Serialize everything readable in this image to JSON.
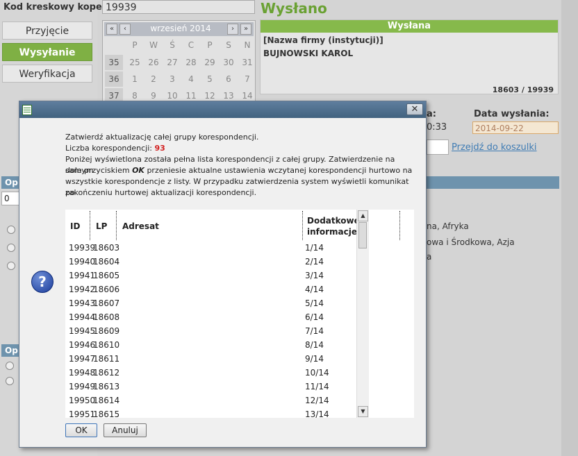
{
  "header": {
    "barcode_label": "Kod kreskowy koperty",
    "barcode_value": "19939",
    "status_title": "Wysłano"
  },
  "nav": [
    {
      "label": "Przyjęcie",
      "active": false
    },
    {
      "label": "Wysyłanie",
      "active": true
    },
    {
      "label": "Weryfikacja",
      "active": false
    }
  ],
  "calendar": {
    "title": "wrzesień 2014",
    "prev_year": "«",
    "prev_month": "‹",
    "next_month": "›",
    "next_year": "»",
    "day_names": [
      "P",
      "W",
      "Ś",
      "C",
      "P",
      "S",
      "N"
    ],
    "weeks": [
      {
        "week": "35",
        "days": [
          "25",
          "26",
          "27",
          "28",
          "29",
          "30",
          "31"
        ]
      },
      {
        "week": "36",
        "days": [
          "1",
          "2",
          "3",
          "4",
          "5",
          "6",
          "7"
        ]
      },
      {
        "week": "37",
        "days": [
          "8",
          "9",
          "10",
          "11",
          "12",
          "13",
          "14"
        ]
      }
    ]
  },
  "panel": {
    "header": "Wysłana",
    "firm_label": "[Nazwa firmy (instytucji)]",
    "name": "BUJNOWSKI KAROL",
    "numbers": "18603 / 19939"
  },
  "background_right": {
    "time_fragment": "0:33",
    "label_fragment": "a:",
    "send_date_label": "Data wysłania:",
    "send_date_value": "2014-09-22",
    "basket_link": "Przejdź do koszulki",
    "region_1": "na, Afryka",
    "region_2": "owa i Środkowa, Azja",
    "region_3": "a"
  },
  "background_left": {
    "op_label_1": "Op",
    "op_label_2": "Op",
    "field_value": "0"
  },
  "dialog": {
    "line1": "Zatwierdź aktualizację całej grupy korespondencji.",
    "count_label": "Liczba korespondencji:",
    "count_value": "93",
    "line3": "Poniżej wyświetlona została pełna lista korespondencji z całej grupy. Zatwierdzenie na samym",
    "line4_pre": "dole przyciskiem",
    "line4_ok": "OK",
    "line4_post": "przeniesie aktualne ustawienia wczytanej korespondencji hurtowo na",
    "line5": "wszystkie korespondencje z listy. W przypadku zatwierdzenia system wyświetli komunikat po",
    "line6": "zakończeniu hurtowej aktualizacji korespondencji.",
    "close_symbol": "✕",
    "help_symbol": "?",
    "columns": {
      "id": "ID",
      "lp": "LP",
      "address": "Adresat",
      "extra_1": "Dodatkowe",
      "extra_2": "informacje"
    },
    "rows": [
      {
        "id": "19939",
        "lp": "18603",
        "info": "1/14"
      },
      {
        "id": "19940",
        "lp": "18604",
        "info": "2/14"
      },
      {
        "id": "19941",
        "lp": "18605",
        "info": "3/14"
      },
      {
        "id": "19942",
        "lp": "18606",
        "info": "4/14"
      },
      {
        "id": "19943",
        "lp": "18607",
        "info": "5/14"
      },
      {
        "id": "19944",
        "lp": "18608",
        "info": "6/14"
      },
      {
        "id": "19945",
        "lp": "18609",
        "info": "7/14"
      },
      {
        "id": "19946",
        "lp": "18610",
        "info": "8/14"
      },
      {
        "id": "19947",
        "lp": "18611",
        "info": "9/14"
      },
      {
        "id": "19948",
        "lp": "18612",
        "info": "10/14"
      },
      {
        "id": "19949",
        "lp": "18613",
        "info": "11/14"
      },
      {
        "id": "19950",
        "lp": "18614",
        "info": "12/14"
      },
      {
        "id": "19951",
        "lp": "18615",
        "info": "13/14"
      }
    ],
    "ok_label": "OK",
    "cancel_label": "Anuluj"
  },
  "colors": {
    "accent_green": "#7fb044",
    "count_red": "#d21f1f",
    "title_bar": "#4a6a88"
  }
}
